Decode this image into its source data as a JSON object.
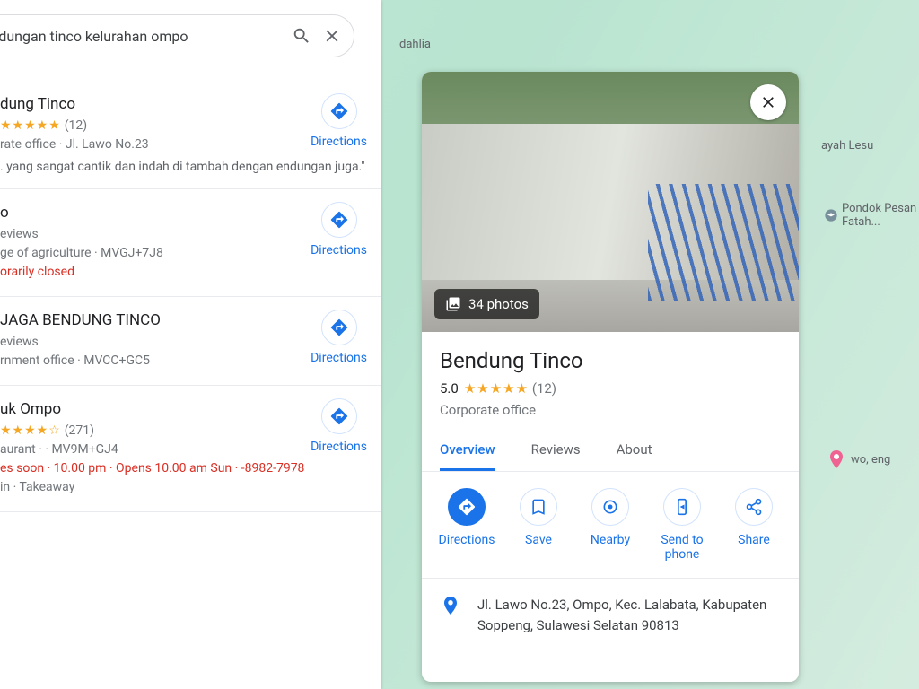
{
  "search": {
    "query": "endungan tinco kelurahan ompo"
  },
  "results": [
    {
      "title": "dung Tinco",
      "rating": "5.0",
      "stars": "★★★★★",
      "count": "(12)",
      "meta": "rate office · Jl. Lawo No.23",
      "snippet": ". yang sangat cantik dan indah di tambah dengan endungan juga.\"",
      "dirlabel": "Directions"
    },
    {
      "title": "o",
      "reviews": "eviews",
      "meta": "ge of agriculture · MVGJ+7J8",
      "closed": "orarily closed",
      "dirlabel": "Directions"
    },
    {
      "title": " JAGA BENDUNG TINCO",
      "reviews": "eviews",
      "meta": "rnment office · MVCC+GC5",
      "dirlabel": "Directions"
    },
    {
      "title": "uk Ompo",
      "rating": "4.5",
      "stars": "★★★★☆",
      "count": "(271)",
      "meta": "aurant ·  · MV9M+GJ4",
      "hours": "es soon · 10.00 pm · Opens 10.00 am Sun · -8982-7978",
      "extra": "in · Takeaway",
      "dirlabel": "Directions"
    }
  ],
  "map_labels": {
    "dahlia": "dahlia",
    "ayah": "ayah Lesu",
    "pondok": "Pondok Pesan Fatah...",
    "hotel": "wo, eng"
  },
  "detail": {
    "photos": "34 photos",
    "title": "Bendung Tinco",
    "rating": "5.0",
    "stars": "★★★★★",
    "count": "(12)",
    "category": "Corporate office",
    "tabs": {
      "overview": "Overview",
      "reviews": "Reviews",
      "about": "About"
    },
    "actions": {
      "directions": "Directions",
      "save": "Save",
      "nearby": "Nearby",
      "send": "Send to phone",
      "share": "Share"
    },
    "address": "Jl. Lawo No.23, Ompo, Kec. Lalabata, Kabupaten Soppeng, Sulawesi Selatan 90813"
  }
}
